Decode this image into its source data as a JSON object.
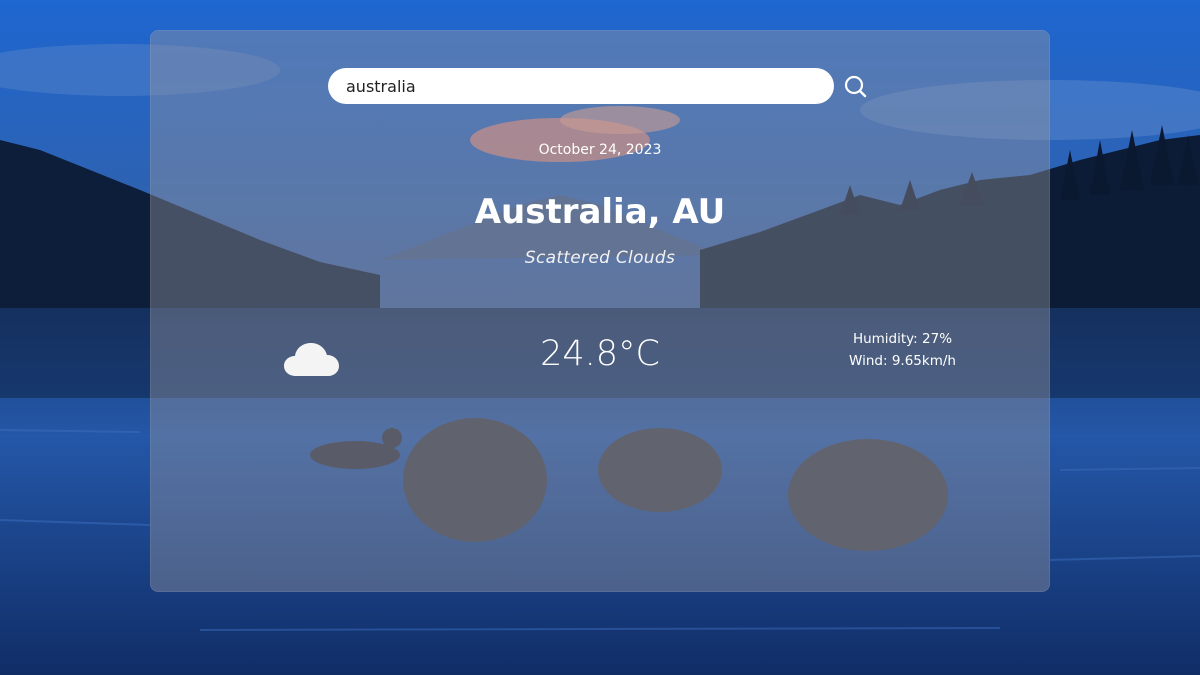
{
  "search": {
    "value": "australia",
    "placeholder": ""
  },
  "icons": {
    "search_button": "search-icon",
    "weather": "cloud-icon"
  },
  "weather": {
    "date": "October 24, 2023",
    "location": "Australia, AU",
    "condition": "Scattered Clouds",
    "temperature": "24.8°C",
    "humidity": "Humidity: 27%",
    "wind": "Wind: 9.65km/h"
  },
  "colors": {
    "sky": "#1f63c7",
    "water": "#1e4f9a",
    "card_overlay": "#9696a0",
    "text": "#ffffff"
  }
}
